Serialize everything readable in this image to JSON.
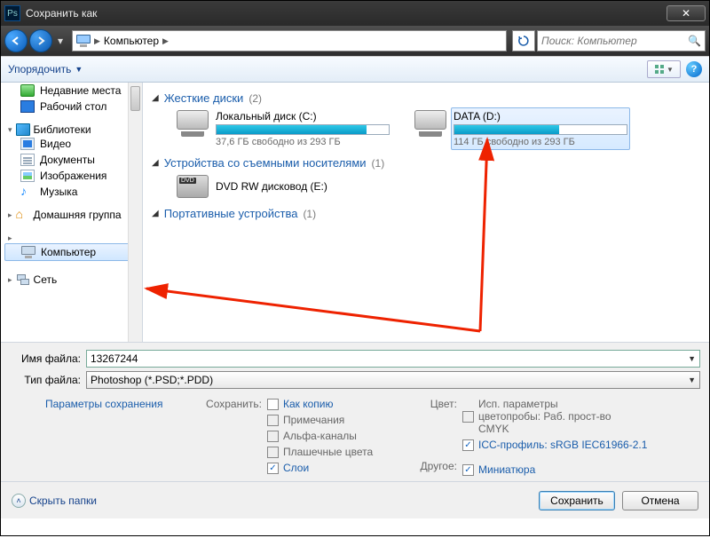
{
  "window": {
    "title": "Сохранить как"
  },
  "nav": {
    "breadcrumb_location": "Компьютер",
    "search_placeholder": "Поиск: Компьютер"
  },
  "toolbar": {
    "organize": "Упорядочить"
  },
  "sidebar": {
    "recent": "Недавние места",
    "desktop": "Рабочий стол",
    "libraries": "Библиотеки",
    "videos": "Видео",
    "documents": "Документы",
    "images": "Изображения",
    "music": "Музыка",
    "homegroup": "Домашняя группа",
    "computer": "Компьютер",
    "network": "Сеть"
  },
  "content": {
    "group_hdd": {
      "label": "Жесткие диски",
      "count": "(2)"
    },
    "drive_c": {
      "name": "Локальный диск (C:)",
      "free": "37,6 ГБ свободно из 293 ГБ",
      "fill_pct": 87
    },
    "drive_d": {
      "name": "DATA (D:)",
      "free": "114 ГБ свободно из 293 ГБ",
      "fill_pct": 61
    },
    "group_removable": {
      "label": "Устройства со съемными носителями",
      "count": "(1)"
    },
    "dvd": {
      "name": "DVD RW дисковод (E:)"
    },
    "group_portable": {
      "label": "Портативные устройства",
      "count": "(1)"
    }
  },
  "form": {
    "filename_label": "Имя файла:",
    "filename_value": "13267244",
    "filetype_label": "Тип файла:",
    "filetype_value": "Photoshop (*.PSD;*.PDD)",
    "save_params": "Параметры сохранения",
    "save_group_label": "Сохранить:",
    "chk_copy": "Как копию",
    "chk_notes": "Примечания",
    "chk_alpha": "Альфа-каналы",
    "chk_spot": "Плашечные цвета",
    "chk_layers": "Слои",
    "color_group_label": "Цвет:",
    "chk_cmyk": "Исп. параметры цветопробы: Раб. прост-во CMYK",
    "chk_icc": "ICC-профиль: sRGB IEC61966-2.1",
    "other_label": "Другое:",
    "chk_thumb": "Миниатюра"
  },
  "footer": {
    "hide_folders": "Скрыть папки",
    "save": "Сохранить",
    "cancel": "Отмена"
  }
}
